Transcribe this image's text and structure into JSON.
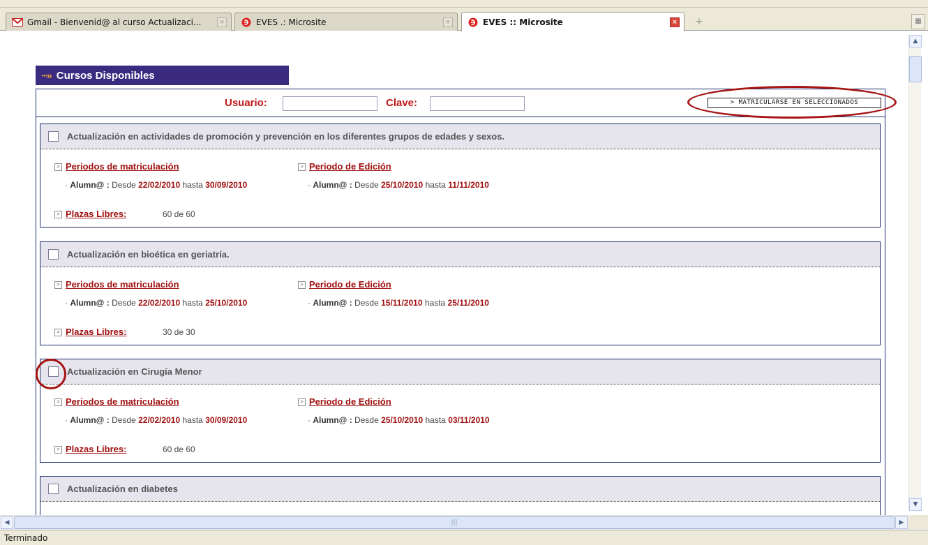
{
  "browser": {
    "tabs": [
      {
        "label": "Gmail - Bienvenid@ al curso Actualizaci...",
        "icon": "gmail-icon",
        "active": false
      },
      {
        "label": "EVES .: Microsite",
        "icon": "eves-icon",
        "active": false
      },
      {
        "label": "EVES :: Microsite",
        "icon": "eves-icon",
        "active": true
      }
    ],
    "new_tab_glyph": "+",
    "status": "Terminado"
  },
  "page": {
    "section_title": "Cursos Disponibles",
    "usuario_label": "Usuario:",
    "clave_label": "Clave:",
    "usuario_value": "",
    "clave_value": "",
    "enroll_button": "> MATRICULARSE EN SELECCIONADOS"
  },
  "course_labels": {
    "periodos": "Periodos de matriculación",
    "edicion": "Periodo de Edición",
    "plazas": "Plazas Libres:",
    "role": "Alumn@ :",
    "desde": "Desde",
    "hasta": "hasta"
  },
  "courses": [
    {
      "title": "Actualización en actividades de promoción y prevención en los diferentes grupos de edades y sexos.",
      "mat_from": "22/02/2010",
      "mat_to": "30/09/2010",
      "ed_from": "25/10/2010",
      "ed_to": "11/11/2010",
      "plazas": "60 de 60"
    },
    {
      "title": "Actualización en bioética en geriatría.",
      "mat_from": "22/02/2010",
      "mat_to": "25/10/2010",
      "ed_from": "15/11/2010",
      "ed_to": "25/11/2010",
      "plazas": "30 de 30"
    },
    {
      "title": "Actualización en Cirugía Menor",
      "mat_from": "22/02/2010",
      "mat_to": "30/09/2010",
      "ed_from": "25/10/2010",
      "ed_to": "03/11/2010",
      "plazas": "60 de 60"
    },
    {
      "title": "Actualización en diabetes",
      "mat_from": "",
      "mat_to": "",
      "ed_from": "",
      "ed_to": "",
      "plazas": ""
    }
  ],
  "colors": {
    "header_bar": "#3a2a80",
    "accent_red": "#a01010",
    "border_navy": "#1c2a6e"
  }
}
